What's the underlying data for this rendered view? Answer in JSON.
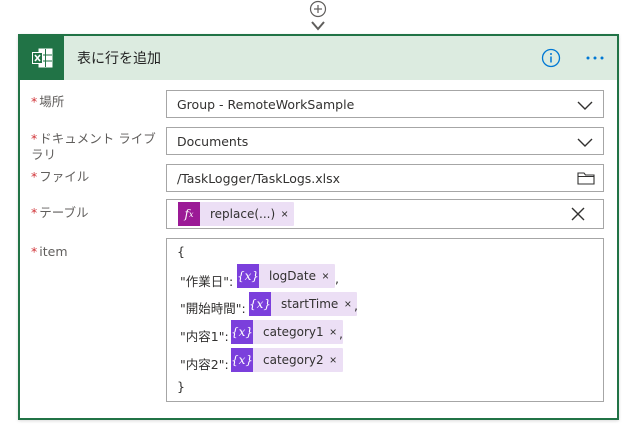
{
  "card": {
    "title": "表に行を追加"
  },
  "fields": {
    "location": {
      "label": "場所",
      "value": "Group - RemoteWorkSample"
    },
    "library": {
      "label_line1": "ドキュメント ライブ",
      "label_line2": "ラリ",
      "value": "Documents"
    },
    "file": {
      "label": "ファイル",
      "value": "/TaskLogger/TaskLogs.xlsx"
    },
    "table": {
      "label": "テーブル",
      "token": {
        "icon": "fx",
        "label": "replace(...)"
      }
    },
    "item": {
      "label": "item",
      "open_brace": "{",
      "close_brace": "}",
      "rows": [
        {
          "key": "\"作業日\":",
          "icon": "{x}",
          "token": "logDate",
          "suffix": ","
        },
        {
          "key": "\"開始時間\":",
          "icon": "{x}",
          "token": "startTime",
          "suffix": ","
        },
        {
          "key": "\"内容1\":",
          "icon": "{x}",
          "token": "category1",
          "suffix": ","
        },
        {
          "key": "\"内容2\":",
          "icon": "{x}",
          "token": "category2",
          "suffix": ""
        }
      ]
    }
  },
  "required_marker": "*",
  "token_remove": "×",
  "colors": {
    "excel_green": "#217346",
    "header_bg": "#dcebe0",
    "required_red": "#d13438",
    "fx_token": "#9b1a96",
    "var_token": "#7b3fdc",
    "token_bg": "#ecdff5",
    "info_blue": "#0078d4"
  },
  "icons": {
    "connector": "add-step-icon",
    "app": "excel-icon",
    "info": "info-icon",
    "more": "more-options-icon",
    "dropdown": "chevron-down-icon",
    "file_picker": "folder-icon",
    "clear": "close-icon"
  }
}
